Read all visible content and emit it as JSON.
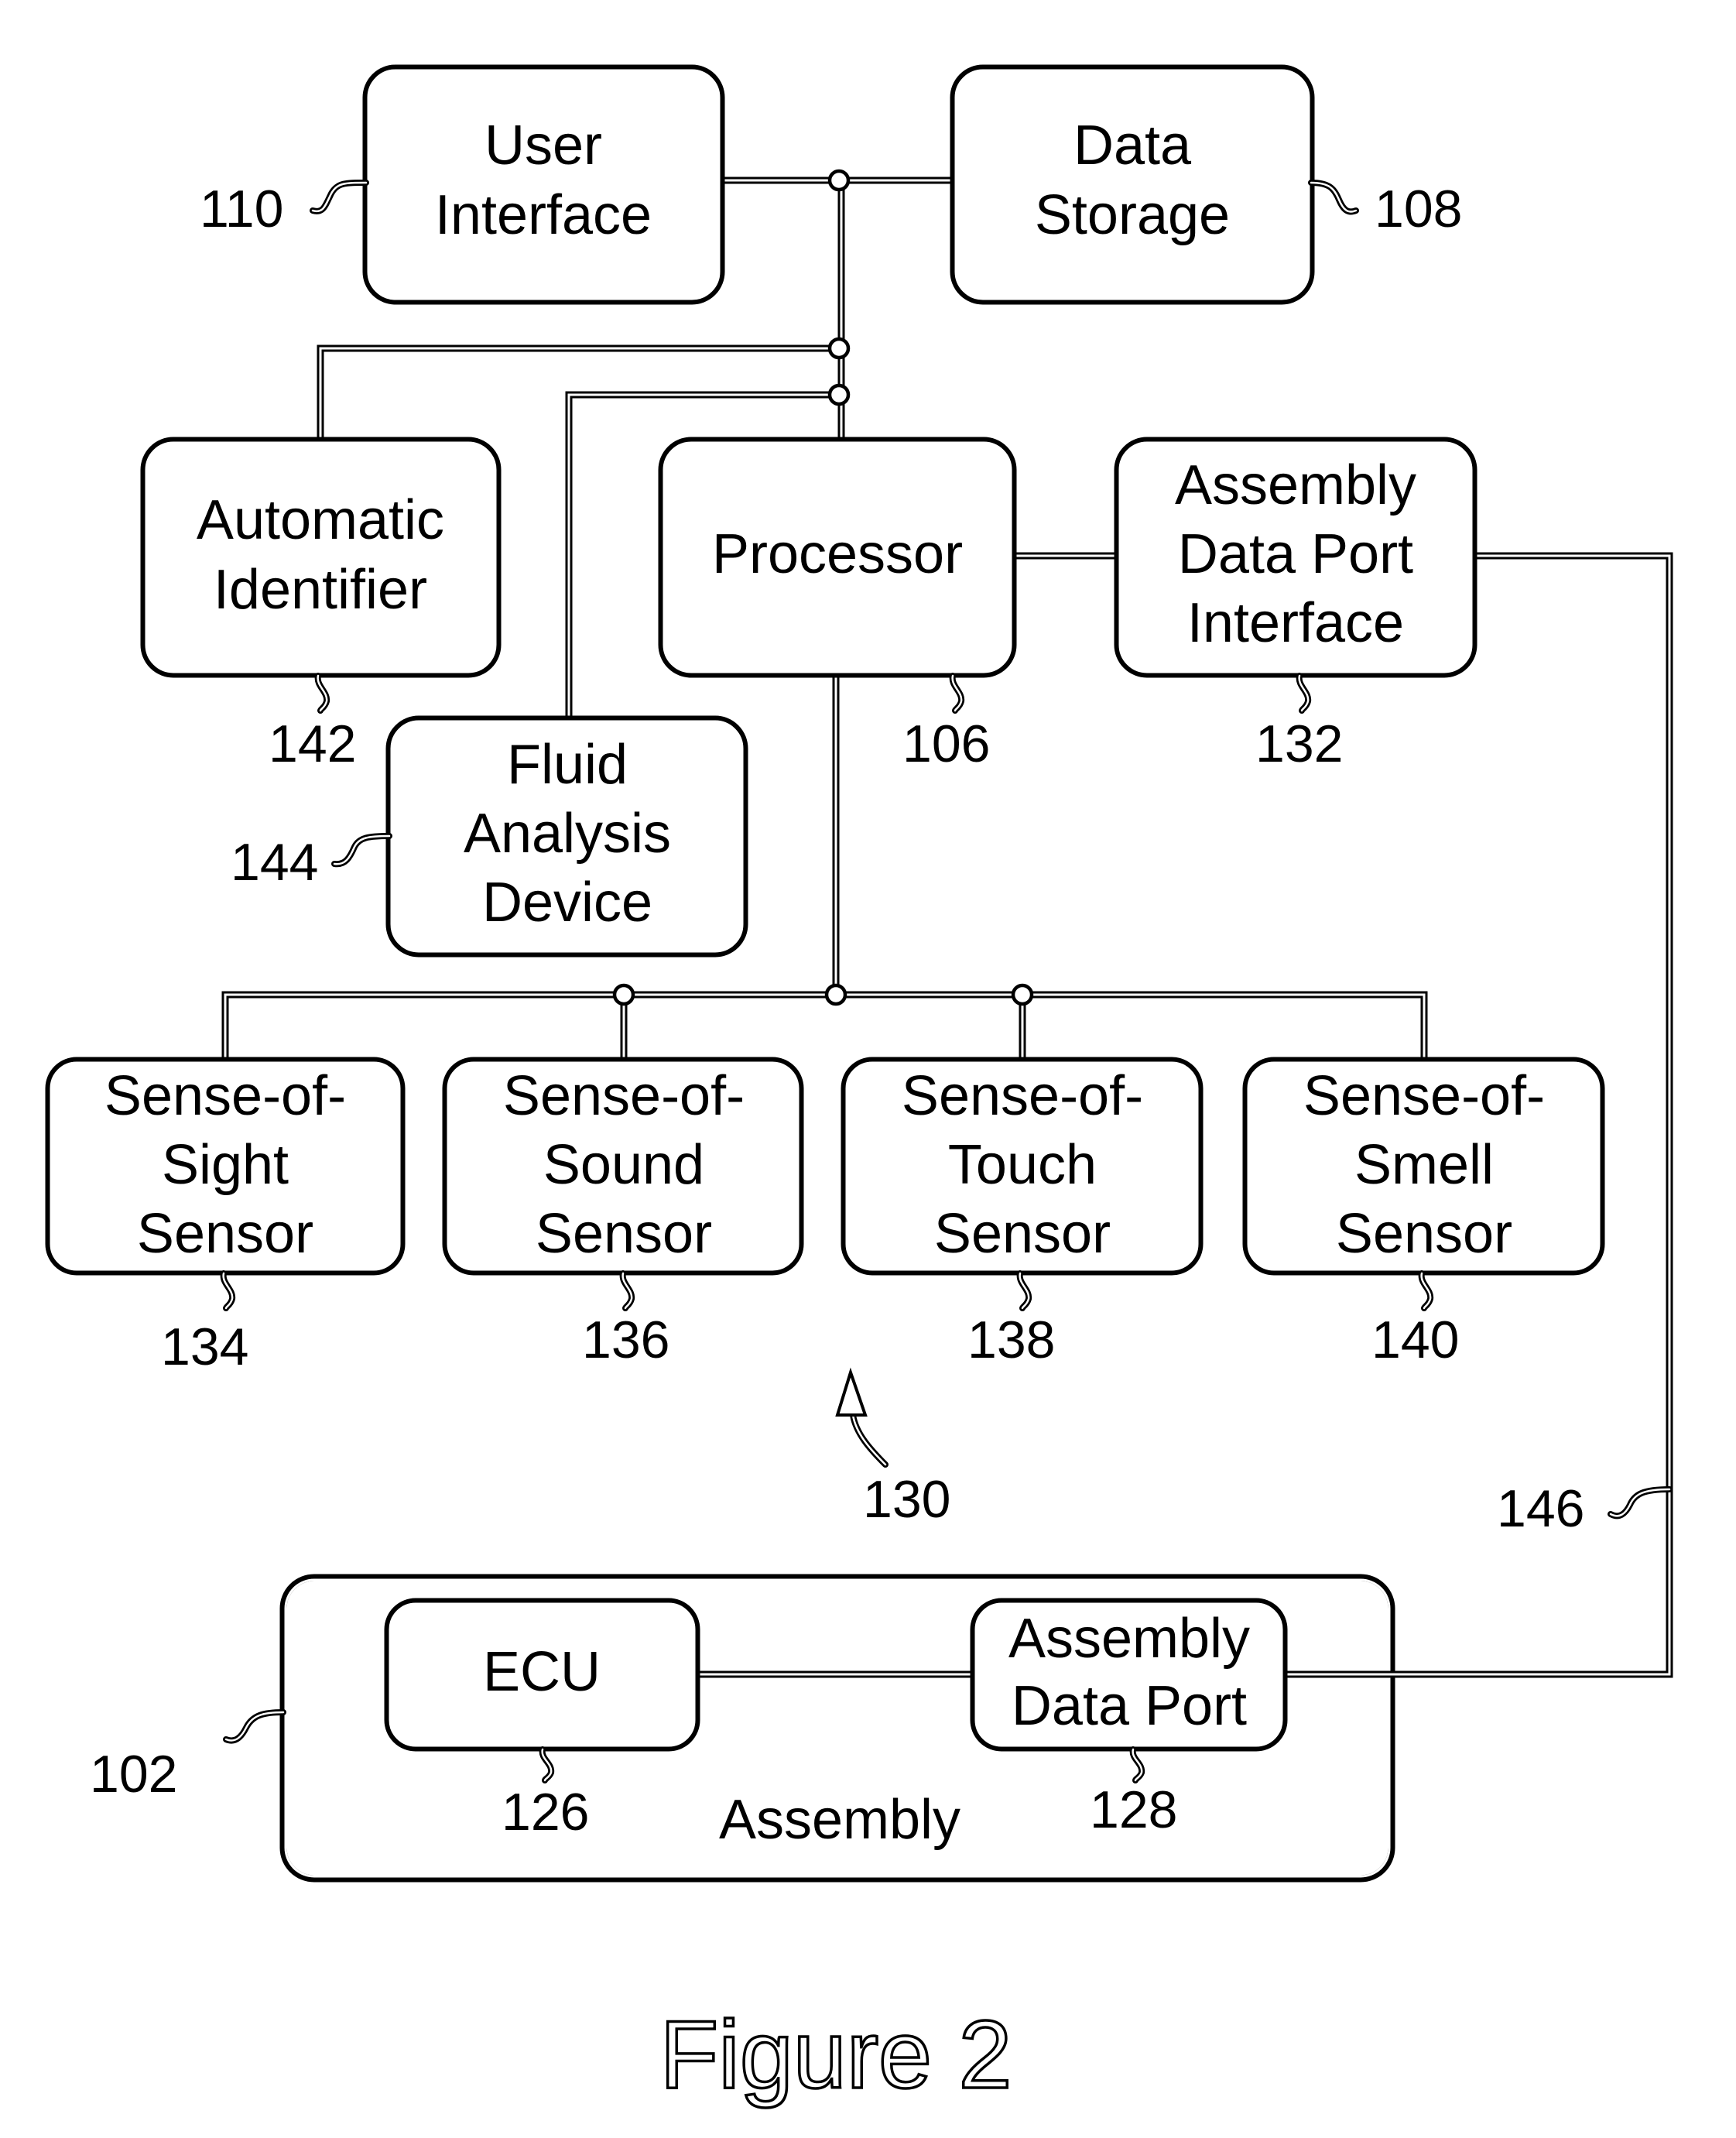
{
  "figure": {
    "caption": "Figure 2"
  },
  "blocks": {
    "user_interface": {
      "lines": [
        "User",
        "Interface"
      ],
      "ref": "110"
    },
    "data_storage": {
      "lines": [
        "Data",
        "Storage"
      ],
      "ref": "108"
    },
    "automatic_identifier": {
      "lines": [
        "Automatic",
        "Identifier"
      ],
      "ref": "142"
    },
    "processor": {
      "lines": [
        "Processor"
      ],
      "ref": "106"
    },
    "assembly_data_port_interface": {
      "lines": [
        "Assembly",
        "Data Port",
        "Interface"
      ],
      "ref": "132"
    },
    "fluid_analysis_device": {
      "lines": [
        "Fluid",
        "Analysis",
        "Device"
      ],
      "ref": "144"
    },
    "sense_of_sight_sensor": {
      "lines": [
        "Sense-of-",
        "Sight",
        "Sensor"
      ],
      "ref": "134"
    },
    "sense_of_sound_sensor": {
      "lines": [
        "Sense-of-",
        "Sound",
        "Sensor"
      ],
      "ref": "136"
    },
    "sense_of_touch_sensor": {
      "lines": [
        "Sense-of-",
        "Touch",
        "Sensor"
      ],
      "ref": "138"
    },
    "sense_of_smell_sensor": {
      "lines": [
        "Sense-of-",
        "Smell",
        "Sensor"
      ],
      "ref": "140"
    },
    "assembly": {
      "label": "Assembly",
      "ref": "102"
    },
    "ecu": {
      "lines": [
        "ECU"
      ],
      "ref": "126"
    },
    "assembly_data_port": {
      "lines": [
        "Assembly",
        "Data Port"
      ],
      "ref": "128"
    }
  },
  "references": {
    "sensor_group": "130",
    "data_link": "146"
  }
}
